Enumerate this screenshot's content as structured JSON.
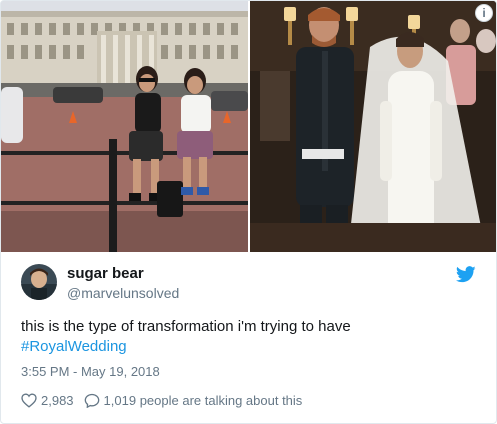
{
  "tweet": {
    "display_name": "sugar bear",
    "handle": "@marvelunsolved",
    "text_main": "this is the type of transformation i'm trying to have",
    "hashtag": "#RoyalWedding",
    "timestamp": "3:55 PM - May 19, 2018",
    "likes": "2,983",
    "replies_text": "1,019 people are talking about this"
  },
  "icons": {
    "info": "info-icon",
    "brand": "twitter-bird-icon",
    "like": "heart-icon",
    "reply": "speech-bubble-icon"
  },
  "colors": {
    "link": "#1b95e0",
    "muted": "#657786",
    "text": "#14171a",
    "border": "#e1e8ed"
  }
}
